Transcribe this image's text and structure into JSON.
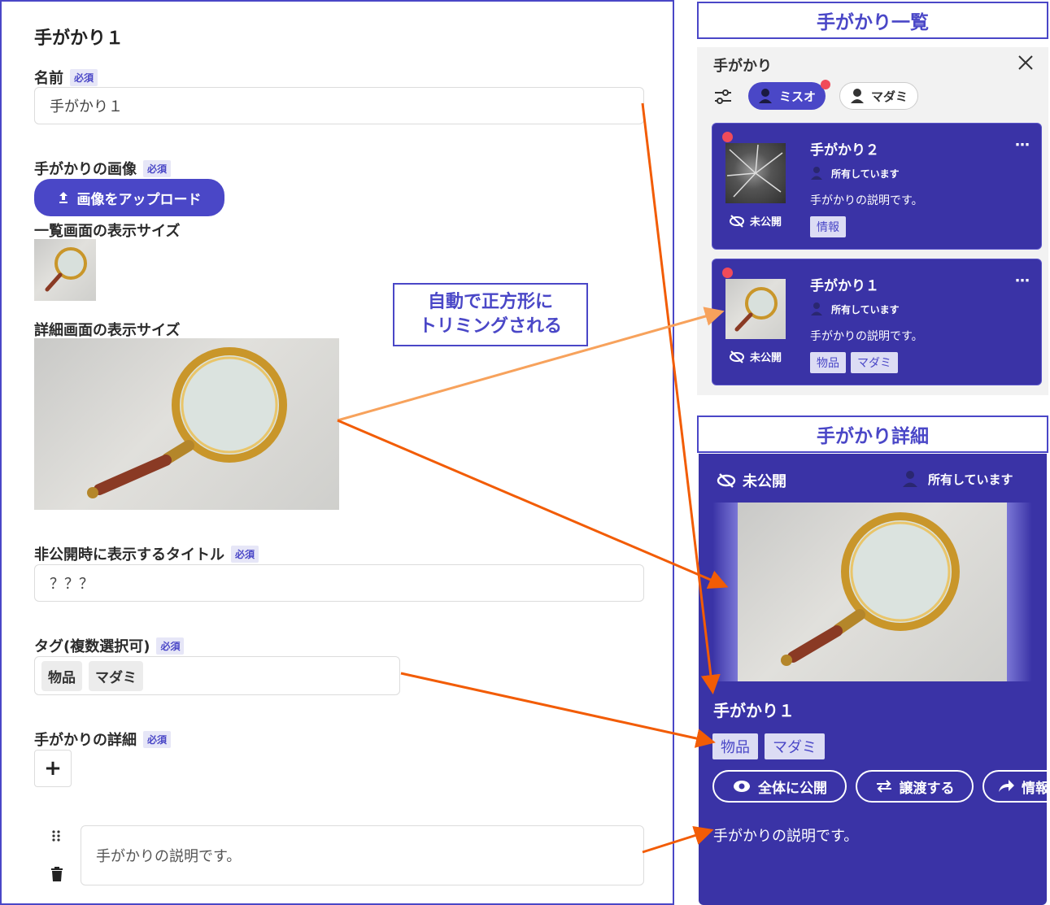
{
  "editor": {
    "title": "手がかり１",
    "required_badge": "必須",
    "name_label": "名前",
    "name_value": "手がかり１",
    "image_label": "手がかりの画像",
    "upload_button": "画像をアップロード",
    "list_size_label": "一覧画面の表示サイズ",
    "detail_size_label": "詳細画面の表示サイズ",
    "hidden_title_label": "非公開時に表示するタイトル",
    "hidden_title_value": "？？？",
    "tags_label": "タグ(複数選択可)",
    "tags": [
      "物品",
      "マダミ"
    ],
    "details_label": "手がかりの詳細",
    "add_button": "+",
    "description_value": "手がかりの説明です。"
  },
  "callout": {
    "line1": "自動で正方形に",
    "line2": "トリミングされる"
  },
  "list_header": "手がかり一覧",
  "list_panel": {
    "title": "手がかり",
    "filters": [
      "ミスオ",
      "マダミ"
    ],
    "cards": [
      {
        "title": "手がかり２",
        "owner": "所有しています",
        "description": "手がかりの説明です。",
        "status": "未公開",
        "tags": [
          "情報"
        ]
      },
      {
        "title": "手がかり１",
        "owner": "所有しています",
        "description": "手がかりの説明です。",
        "status": "未公開",
        "tags": [
          "物品",
          "マダミ"
        ]
      }
    ]
  },
  "detail_header": "手がかり詳細",
  "detail_panel": {
    "status": "未公開",
    "owner": "所有しています",
    "title": "手がかり１",
    "tags": [
      "物品",
      "マダミ"
    ],
    "actions": [
      "全体に公開",
      "譲渡する",
      "情報"
    ],
    "description": "手がかりの説明です。"
  },
  "colors": {
    "accent": "#4a47c7",
    "card_bg": "#3a33a6",
    "arrow": "#f25c05",
    "arrow_light": "#f7a25c",
    "notify_dot": "#f04b5a"
  }
}
